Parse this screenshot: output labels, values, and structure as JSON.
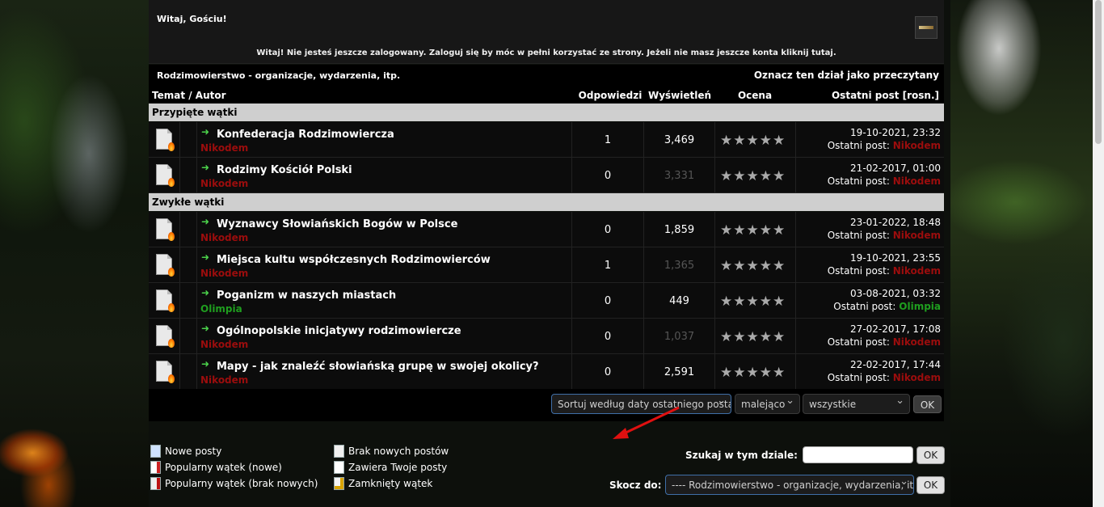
{
  "welcome": {
    "greeting": "Witaj, Gościu!",
    "message": "Witaj! Nie jesteś jeszcze zalogowany. Zaloguj się by móc w pełni korzystać ze strony. Jeżeli nie masz jeszcze konta kliknij tutaj."
  },
  "forum": {
    "title": "Rodzimowierstwo - organizacje, wydarzenia, itp.",
    "mark_read": "Oznacz ten dział jako przeczytany"
  },
  "columns": {
    "topic": "Temat / Autor",
    "replies": "Odpowiedzi",
    "views": "Wyświetleń",
    "rating": "Ocena",
    "last_post": "Ostatni post [rosn.]"
  },
  "sections": {
    "pinned": "Przypięte wątki",
    "normal": "Zwykłe wątki"
  },
  "last_post_prefix": "Ostatni post:",
  "rating_stars": "★★★★★",
  "pinned_threads": [
    {
      "title": "Konfederacja Rodzimowiercza",
      "author": "Nikodem",
      "replies": "1",
      "views": "3,469",
      "views_dim": false,
      "date": "19-10-2021, 23:32",
      "last_author": "Nikodem",
      "author_color": "red"
    },
    {
      "title": "Rodzimy Kościół Polski",
      "author": "Nikodem",
      "replies": "0",
      "views": "3,331",
      "views_dim": true,
      "date": "21-02-2017, 01:00",
      "last_author": "Nikodem",
      "author_color": "red"
    }
  ],
  "threads": [
    {
      "title": "Wyznawcy Słowiańskich Bogów w Polsce",
      "author": "Nikodem",
      "replies": "0",
      "views": "1,859",
      "views_dim": false,
      "date": "23-01-2022, 18:48",
      "last_author": "Nikodem",
      "author_color": "red"
    },
    {
      "title": "Miejsca kultu współczesnych Rodzimowierców",
      "author": "Nikodem",
      "replies": "1",
      "views": "1,365",
      "views_dim": true,
      "date": "19-10-2021, 23:55",
      "last_author": "Nikodem",
      "author_color": "red"
    },
    {
      "title": "Poganizm w naszych miastach",
      "author": "Olimpia",
      "replies": "0",
      "views": "449",
      "views_dim": false,
      "date": "03-08-2021, 03:32",
      "last_author": "Olimpia",
      "author_color": "green"
    },
    {
      "title": "Ogólnopolskie inicjatywy rodzimowiercze",
      "author": "Nikodem",
      "replies": "0",
      "views": "1,037",
      "views_dim": true,
      "date": "27-02-2017, 17:08",
      "last_author": "Nikodem",
      "author_color": "red"
    },
    {
      "title": "Mapy - jak znaleźć słowiańską grupę w swojej okolicy?",
      "author": "Nikodem",
      "replies": "0",
      "views": "2,591",
      "views_dim": false,
      "date": "22-02-2017, 17:44",
      "last_author": "Nikodem",
      "author_color": "red"
    }
  ],
  "sort": {
    "by": "Sortuj według daty ostatniego posta",
    "order": "malejąco",
    "range": "wszystkie",
    "ok": "OK"
  },
  "legend": {
    "new_posts": "Nowe posty",
    "hot_new": "Popularny wątek (nowe)",
    "hot_old": "Popularny wątek (brak nowych)",
    "no_new": "Brak nowych postów",
    "yours": "Zawiera Twoje posty",
    "locked": "Zamknięty wątek"
  },
  "search": {
    "label": "Szukaj w tym dziale:",
    "value": "",
    "ok": "OK"
  },
  "jump": {
    "label": "Skocz do:",
    "selected": "---- Rodzimowierstwo - organizacje, wydarzenia, itp.",
    "ok": "OK"
  }
}
